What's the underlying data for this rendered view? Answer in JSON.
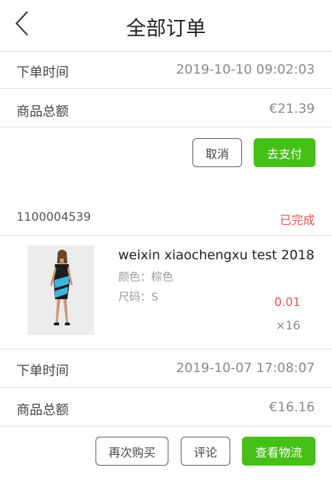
{
  "header": {
    "title": "全部订单"
  },
  "order1": {
    "time_label": "下单时间",
    "time_value": "2019-10-10 09:02:03",
    "total_label": "商品总额",
    "total_value": "€21.39",
    "cancel_label": "取消",
    "pay_label": "去支付"
  },
  "order2": {
    "order_id": "1100004539",
    "status": "已完成",
    "product": {
      "name": "weixin xiaochengxu test 2018",
      "color_attr": "颜色：棕色",
      "size_attr": "尺码：S",
      "price": "0.01",
      "quantity": "×16"
    },
    "time_label": "下单时间",
    "time_value": "2019-10-07 17:08:07",
    "total_label": "商品总额",
    "total_value": "€16.16",
    "rebuy_label": "再次购买",
    "review_label": "评论",
    "logistics_label": "查看物流"
  },
  "colors": {
    "accent_green": "#44c017",
    "status_red": "#ea5454"
  },
  "icons": {
    "back": "chevron-left-icon"
  }
}
